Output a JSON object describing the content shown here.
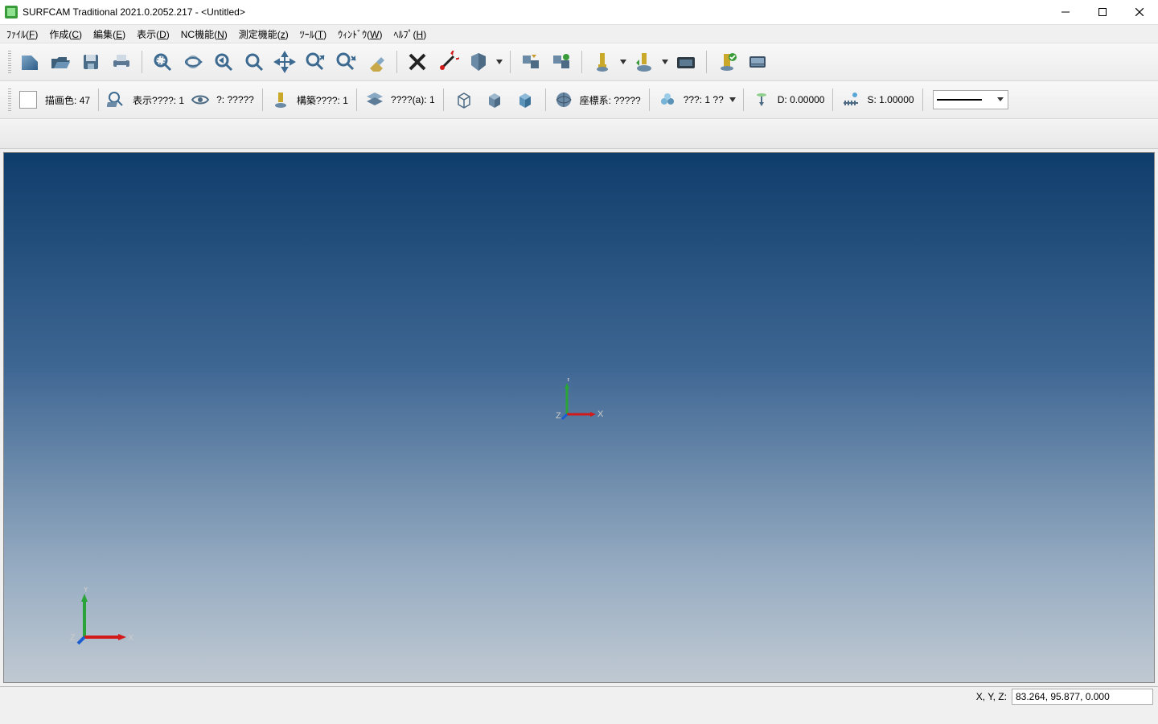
{
  "window": {
    "title": "SURFCAM Traditional 2021.0.2052.217 - <Untitled>"
  },
  "menu": {
    "file": {
      "label": "ﾌｧｲﾙ",
      "accel": "F"
    },
    "create": {
      "label": "作成",
      "accel": "C"
    },
    "edit": {
      "label": "編集",
      "accel": "E"
    },
    "view": {
      "label": "表示",
      "accel": "D"
    },
    "nc": {
      "label": "NC機能",
      "accel": "N"
    },
    "measure": {
      "label": "測定機能",
      "accel": "z"
    },
    "tools": {
      "label": "ﾂｰﾙ",
      "accel": "T"
    },
    "window": {
      "label": "ｳｨﾝﾄﾞｳ",
      "accel": "W"
    },
    "help": {
      "label": "ﾍﾙﾌﾟ",
      "accel": "H"
    }
  },
  "toolbar2": {
    "draw_color": {
      "label": "描画色:",
      "value": "47"
    },
    "view": {
      "label": "表示????:",
      "value": "1"
    },
    "visibility": {
      "label": "?:",
      "value": "?????"
    },
    "construction": {
      "label": "構築????:",
      "value": "1"
    },
    "layers": {
      "label": "????(a):",
      "value": "1"
    },
    "coord": {
      "label": "座標系:",
      "value": "?????"
    },
    "snap": {
      "label": "???: 1 ??",
      "value": ""
    },
    "depth": {
      "label": "D:",
      "value": "0.00000"
    },
    "spacing": {
      "label": "S:",
      "value": "1.00000"
    }
  },
  "axes": {
    "x": "X",
    "y": "Y",
    "z": "Z"
  },
  "statusbar": {
    "label": "X, Y, Z:",
    "coords": "83.264, 95.877, 0.000"
  },
  "colors": {
    "viewport_top": "#0f3d6b",
    "viewport_bottom": "#c0c9d2",
    "x_axis": "#d21a1a",
    "y_axis": "#2aa338",
    "z_axis": "#1a5cd2"
  }
}
